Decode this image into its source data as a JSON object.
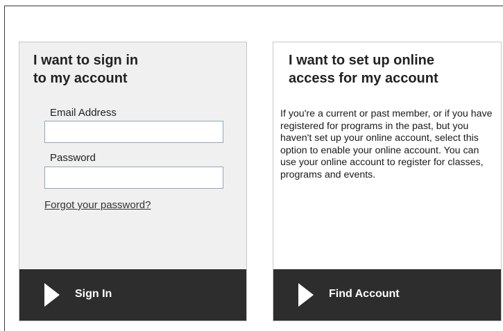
{
  "signin": {
    "title_line1": "I want to sign in",
    "title_line2": "to my account",
    "email_label": "Email Address",
    "email_value": "",
    "password_label": "Password",
    "password_value": "",
    "forgot_link": "Forgot your password?",
    "button_label": "Sign In",
    "button_icon": "play-icon"
  },
  "setup": {
    "title_line1": "I want to set up online",
    "title_line2": "access for my account",
    "description": "If you're a current or past member, or if you have registered for programs in the past, but you haven't set up your online account, select this option to enable your online account. You can use your online account to register for classes, programs and events.",
    "button_label": "Find Account",
    "button_icon": "play-icon"
  },
  "colors": {
    "signin_panel_bg": "#f0f0f0",
    "action_bar_bg": "#2d2d2d",
    "input_border": "#8fa6bd"
  }
}
